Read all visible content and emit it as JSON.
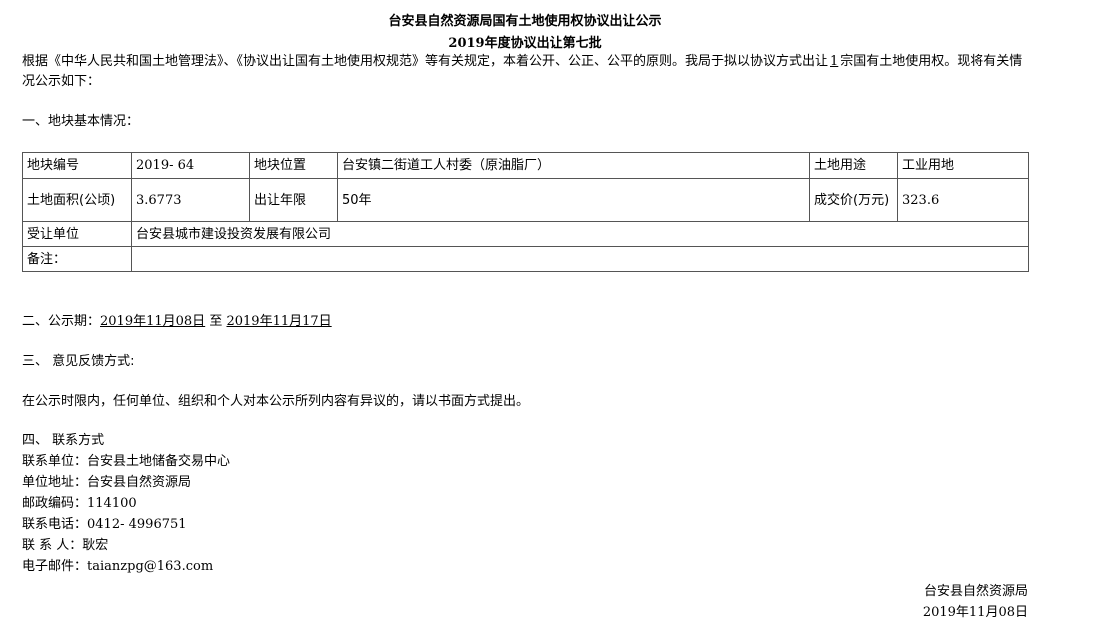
{
  "title": "台安县自然资源局国有土地使用权协议出让公示",
  "subtitle": "2019年度协议出让第七批",
  "intro": {
    "before": "根据《中华人民共和国土地管理法》、《协议出让国有土地使用权规范》等有关规定，本着公开、公正、公平的原则。我局于拟以协议方式出让",
    "count": "1",
    "after": "宗国有土地使用权。现将有关情况公示如下："
  },
  "section1": "一、地块基本情况：",
  "table": {
    "parcel_no_label": "地块编号",
    "parcel_no": "2019- 64",
    "location_label": "地块位置",
    "location": "台安镇二街道工人村委（原油脂厂）",
    "use_label": "土地用途",
    "use": "工业用地",
    "area_label": "土地面积(公顷)",
    "area": "3.6773",
    "term_label": "出让年限",
    "term": "50年",
    "price_label": "成交价(万元)",
    "price": "323.6",
    "grantee_label": "受让单位",
    "grantee": "台安县城市建设投资发展有限公司",
    "remark_label": "备注：",
    "remark": ""
  },
  "section2": {
    "label": "二、公示期：",
    "start": "2019年11月08日",
    "to": "至",
    "end": "2019年11月17日"
  },
  "section3": "三、 意见反馈方式:",
  "feedback": "在公示时限内，任何单位、组织和个人对本公示所列内容有异议的，请以书面方式提出。",
  "section4": "四、 联系方式",
  "contact": {
    "unit_label": "联系单位：",
    "unit": "台安县土地储备交易中心",
    "address_label": "单位地址：",
    "address": "台安县自然资源局",
    "zip_label": "邮政编码：",
    "zip": "114100",
    "phone_label": "联系电话：",
    "phone": "0412- 4996751",
    "person_label": "联 系 人：",
    "person": "耿宏",
    "email_label": "电子邮件：",
    "email": "taianzpg@163.com"
  },
  "signature": {
    "org": "台安县自然资源局",
    "date": "2019年11月08日"
  }
}
